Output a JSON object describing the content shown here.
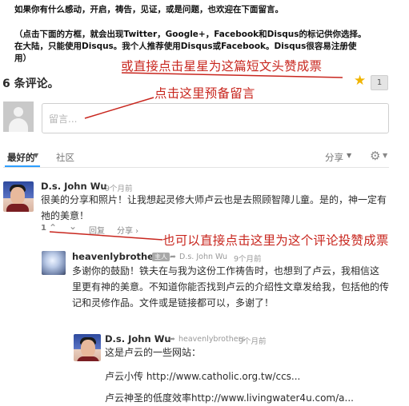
{
  "intro": {
    "line1": "如果你有什么感动，开启，祷告，见证，或是问题，也欢迎在下面留言。",
    "line2": "（点击下面的方框，就会出现Twitter，Google+，Facebook和Disqus的标记供你选择。",
    "line3": "在大陆，只能使用Disqus。我个人推荐使用Disqus或Facebook。Disqus很容易注册使",
    "line4": "用）"
  },
  "annotations": {
    "star_note": "或直接点击星星为这篇短文头赞成票",
    "comment_note": "点击这里预备留言",
    "vote_note": "也可以直接点击这里为这个评论投赞成票",
    "color": "#c8261e"
  },
  "header": {
    "count_title": "6 条评论。",
    "star_icon": "★",
    "recommend_count": "1"
  },
  "composer": {
    "placeholder": "留言..."
  },
  "tabs": {
    "best": "最好的",
    "best_arrow": "▼",
    "community": "社区",
    "share": "分享",
    "share_arrow": "▼",
    "settings_icon": "⚙",
    "settings_arrow": "▼"
  },
  "comments": [
    {
      "author": "D.s. John Wu",
      "time": "9个月前",
      "text_line1": "很美的分享和照片！让我想起灵修大师卢云也是去照顾智障儿童。是的，神一定有",
      "text_line2": "祂的美意！",
      "votes": "1",
      "upvote_icon": "⌃",
      "downvote_icon": "⌄",
      "reply": "回复",
      "share": "分享 ›"
    },
    {
      "author": "heavenlybrothers",
      "moderator_badge": "主人",
      "reply_to_arrow": "➦",
      "reply_to": "D.s. John Wu",
      "time": "9个月前",
      "text_line1": "多谢你的鼓励！铁夫在与我为这份工作祷告时，也想到了卢云，我相信这",
      "text_line2": "里更有神的美意。不知道你能否找到卢云的介绍性文章发给我，包括他的传",
      "text_line3": "记和灵修作品。文件或是链接都可以，多谢了！"
    },
    {
      "author": "D.s. John Wu",
      "reply_to_arrow": "➦",
      "reply_to": "heavenlybrothers",
      "time": "9个月前",
      "text_line1": "这是卢云的一些网站：",
      "text_line2": "卢云小传 http://www.catholic.org.tw/ccs...",
      "text_line3": "卢云神圣的低度效率http://www.livingwater4u.com/a..."
    }
  ]
}
